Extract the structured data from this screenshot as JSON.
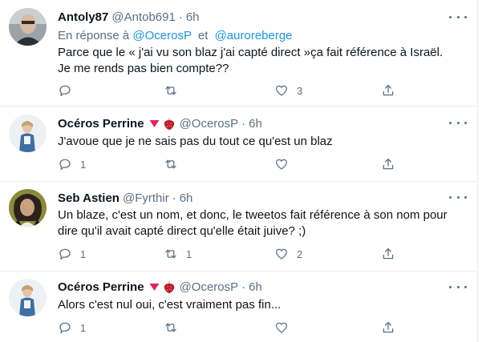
{
  "tweets": [
    {
      "name": "Antoly87",
      "handle": "@Antob691",
      "separator": "·",
      "time": "6h",
      "reply_prefix": "En réponse à",
      "reply_user1": "@OcerosP",
      "reply_and": "et",
      "reply_user2": "@auroreberge",
      "text": "Parce que le « j'ai vu son blaz j'ai capté direct »ça fait référence à Israël. Je me rends pas bien compte??",
      "reply_count": "",
      "retweet_count": "",
      "like_count": "3"
    },
    {
      "name": "Océros Perrine",
      "handle": "@OcerosP",
      "separator": "·",
      "time": "6h",
      "emoji": [
        "red-triangle-down",
        "strawberry"
      ],
      "text": "J'avoue que je ne sais pas du tout ce qu'est un blaz",
      "reply_count": "1",
      "retweet_count": "",
      "like_count": ""
    },
    {
      "name": "Seb Astien",
      "handle": "@Fyrthir",
      "separator": "·",
      "time": "6h",
      "text": "Un blaze, c'est un nom, et donc, le tweetos fait référence à son nom pour dire qu'il avait capté direct qu'elle était juive? ;)",
      "reply_count": "1",
      "retweet_count": "1",
      "like_count": "2"
    },
    {
      "name": "Océros Perrine",
      "handle": "@OcerosP",
      "separator": "·",
      "time": "6h",
      "emoji": [
        "red-triangle-down",
        "strawberry"
      ],
      "text": "Alors c'est nul oui, c'est vraiment pas fin...",
      "reply_count": "1",
      "retweet_count": "",
      "like_count": ""
    }
  ],
  "colors": {
    "text": "#0f1419",
    "secondary": "#5b7083",
    "link": "#1b95e0",
    "divider": "#ebeef0"
  }
}
